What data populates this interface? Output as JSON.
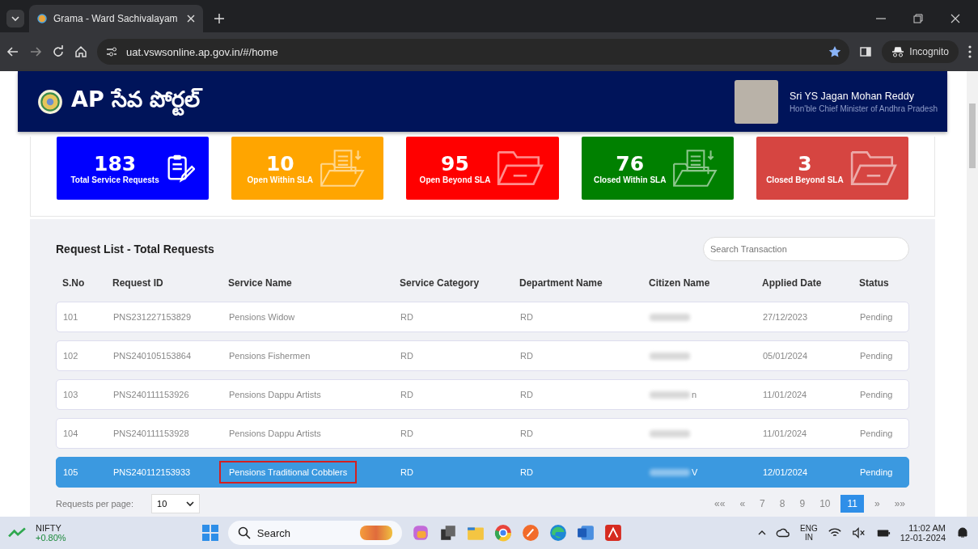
{
  "browser": {
    "tab_title": "Grama - Ward Sachivalayam",
    "url": "uat.vswsonline.ap.gov.in/#/home",
    "profile": "Incognito"
  },
  "header": {
    "logo_text": "AP సేవ పోర్టల్",
    "person_name": "Sri YS Jagan Mohan Reddy",
    "person_title": "Hon'ble Chief Minister of Andhra Pradesh"
  },
  "stats": [
    {
      "value": "183",
      "label": "Total Service Requests",
      "color": "#0000ff",
      "kind": "clipboard"
    },
    {
      "value": "10",
      "label": "Open Within SLA",
      "color": "#ffa500",
      "kind": "doc-folder"
    },
    {
      "value": "95",
      "label": "Open Beyond SLA",
      "color": "#ff0000",
      "kind": "folder"
    },
    {
      "value": "76",
      "label": "Closed Within SLA",
      "color": "#008000",
      "kind": "doc-folder"
    },
    {
      "value": "3",
      "label": "Closed Beyond SLA",
      "color": "#d64541",
      "kind": "folder"
    }
  ],
  "request_list": {
    "title": "Request List - Total Requests",
    "search": {
      "placeholder": "Search Transaction"
    },
    "columns": [
      "S.No",
      "Request ID",
      "Service Name",
      "Service Category",
      "Department Name",
      "Citizen Name",
      "Applied Date",
      "Status"
    ],
    "rows": [
      {
        "sno": "101",
        "request_id": "PNS231227153829",
        "service": "Pensions Widow",
        "category": "RD",
        "department": "RD",
        "citizen": "",
        "date": "27/12/2023",
        "status": "Pending",
        "selected": false,
        "outlined": false
      },
      {
        "sno": "102",
        "request_id": "PNS240105153864",
        "service": "Pensions Fishermen",
        "category": "RD",
        "department": "RD",
        "citizen": "",
        "date": "05/01/2024",
        "status": "Pending",
        "selected": false,
        "outlined": false
      },
      {
        "sno": "103",
        "request_id": "PNS240111153926",
        "service": "Pensions Dappu Artists",
        "category": "RD",
        "department": "RD",
        "citizen": "n",
        "date": "11/01/2024",
        "status": "Pending",
        "selected": false,
        "outlined": false
      },
      {
        "sno": "104",
        "request_id": "PNS240111153928",
        "service": "Pensions Dappu Artists",
        "category": "RD",
        "department": "RD",
        "citizen": "",
        "date": "11/01/2024",
        "status": "Pending",
        "selected": false,
        "outlined": false
      },
      {
        "sno": "105",
        "request_id": "PNS240112153933",
        "service": "Pensions Traditional Cobblers",
        "category": "RD",
        "department": "RD",
        "citizen": "V",
        "date": "12/01/2024",
        "status": "Pending",
        "selected": true,
        "outlined": true
      }
    ],
    "per_page_label": "Requests per page:",
    "per_page": "10",
    "pagination": [
      {
        "label": "««",
        "selected": false
      },
      {
        "label": "«",
        "selected": false
      },
      {
        "label": "7",
        "selected": false
      },
      {
        "label": "8",
        "selected": false
      },
      {
        "label": "9",
        "selected": false
      },
      {
        "label": "10",
        "selected": false
      },
      {
        "label": "11",
        "selected": true
      },
      {
        "label": "»",
        "selected": false
      },
      {
        "label": "»»",
        "selected": false
      }
    ]
  },
  "taskbar": {
    "ticker_name": "NIFTY",
    "ticker_change": "+0.80%",
    "search": "Search",
    "language": "ENG",
    "region": "IN",
    "time": "11:02 AM",
    "date": "12-01-2024"
  }
}
